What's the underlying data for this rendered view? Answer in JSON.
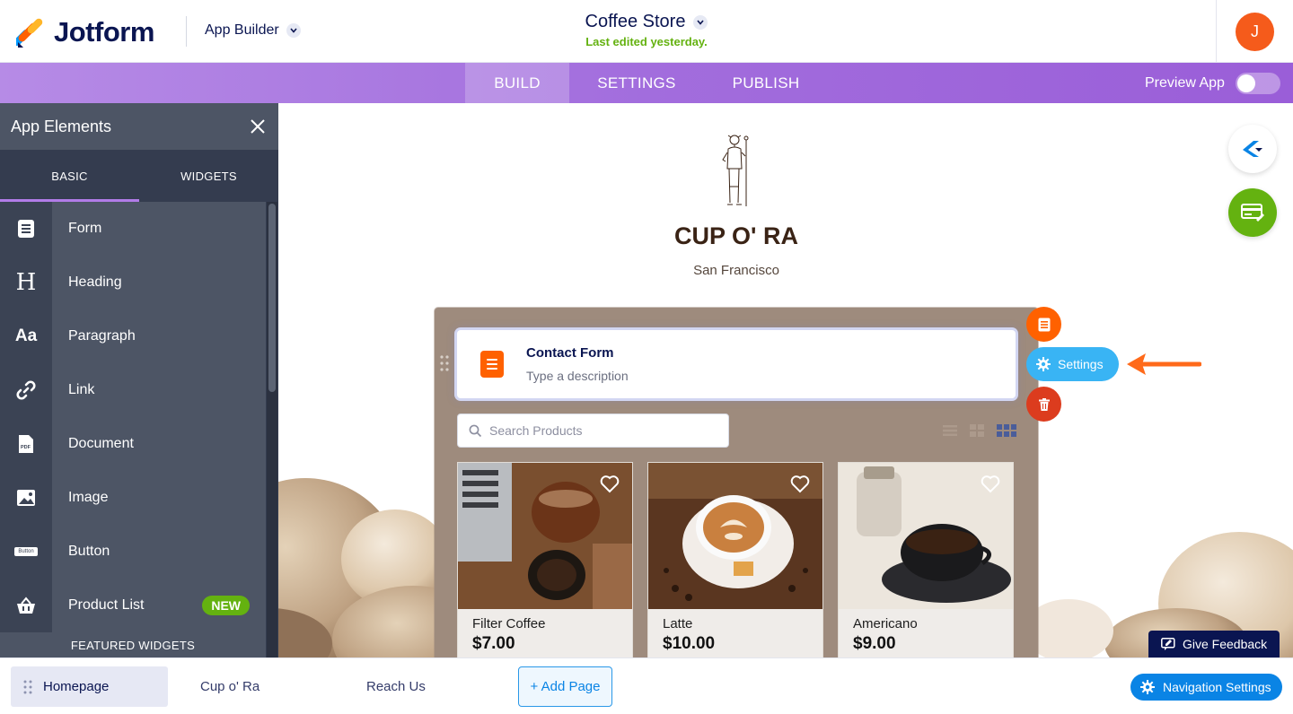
{
  "header": {
    "logo_text": "Jotform",
    "app_builder_label": "App Builder",
    "app_title": "Coffee Store",
    "last_edited": "Last edited yesterday.",
    "avatar_initial": "J"
  },
  "nav": {
    "tabs": [
      {
        "label": "BUILD",
        "active": true
      },
      {
        "label": "SETTINGS",
        "active": false
      },
      {
        "label": "PUBLISH",
        "active": false
      }
    ],
    "preview_label": "Preview App",
    "preview_enabled": false
  },
  "sidebar": {
    "title": "App Elements",
    "tabs": [
      {
        "label": "BASIC",
        "active": true
      },
      {
        "label": "WIDGETS",
        "active": false
      }
    ],
    "items": [
      {
        "label": "Form",
        "icon": "form-icon"
      },
      {
        "label": "Heading",
        "icon": "heading-icon"
      },
      {
        "label": "Paragraph",
        "icon": "paragraph-icon"
      },
      {
        "label": "Link",
        "icon": "link-icon"
      },
      {
        "label": "Document",
        "icon": "document-icon"
      },
      {
        "label": "Image",
        "icon": "image-icon"
      },
      {
        "label": "Button",
        "icon": "button-icon"
      },
      {
        "label": "Product List",
        "icon": "basket-icon",
        "badge": "NEW"
      }
    ],
    "featured_label": "FEATURED WIDGETS",
    "button_icon_text": "Button"
  },
  "canvas": {
    "store_name": "CUP O' RA",
    "store_city": "San Francisco",
    "contact_form": {
      "title": "Contact Form",
      "description": "Type a description"
    },
    "search_placeholder": "Search Products",
    "products": [
      {
        "name": "Filter Coffee",
        "price": "$7.00"
      },
      {
        "name": "Latte",
        "price": "$10.00"
      },
      {
        "name": "Americano",
        "price": "$9.00"
      }
    ],
    "settings_label": "Settings",
    "feedback_label": "Give Feedback"
  },
  "bottom": {
    "pages": [
      {
        "label": "Homepage",
        "active": true
      },
      {
        "label": "Cup o' Ra",
        "active": false
      },
      {
        "label": "Reach Us",
        "active": false
      }
    ],
    "add_page_label": "+ Add Page",
    "nav_settings_label": "Navigation Settings"
  },
  "colors": {
    "brand_navy": "#0a1551",
    "purple_nav": "#a26ddd",
    "green": "#64b210",
    "orange": "#ff6100",
    "blue": "#0a84e5",
    "settings_blue": "#39b4f4",
    "delete_red": "#dc3c1e"
  }
}
